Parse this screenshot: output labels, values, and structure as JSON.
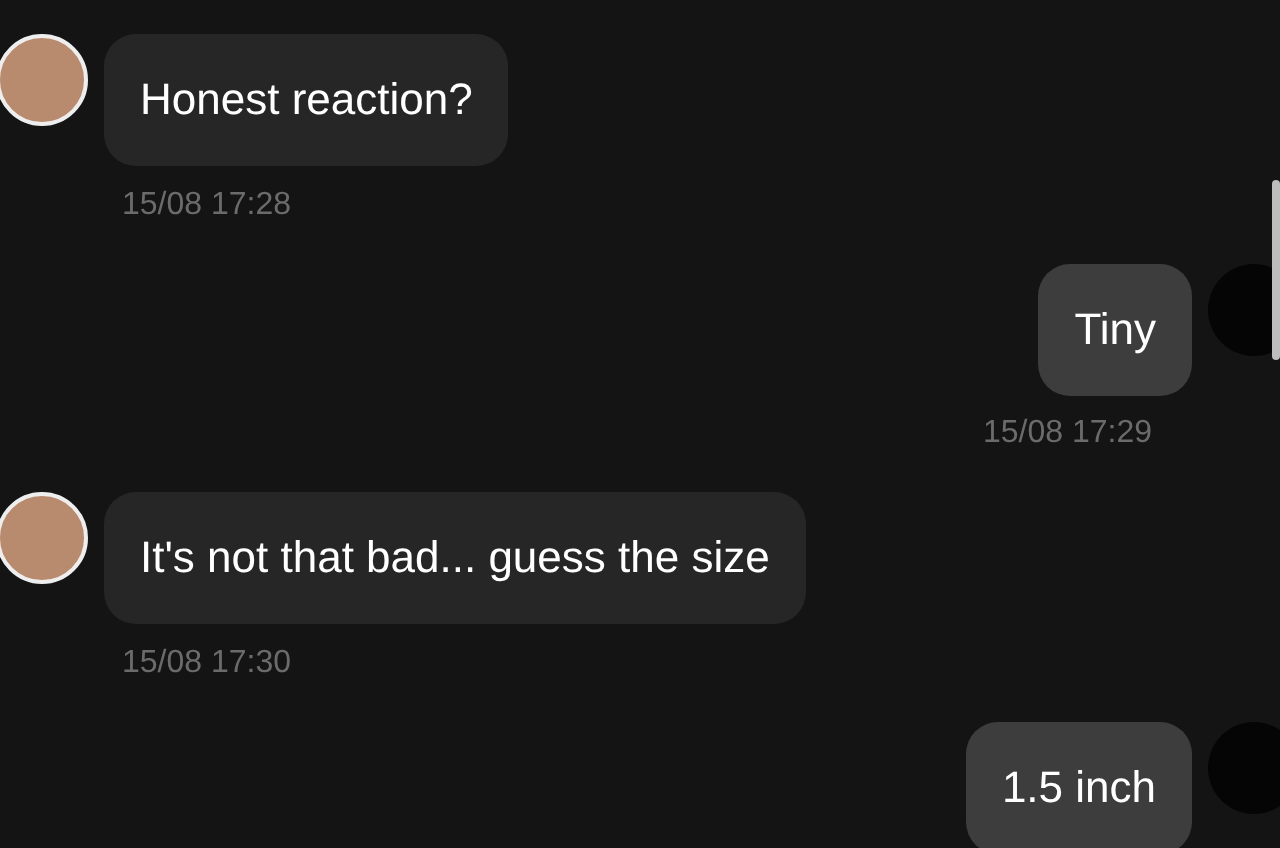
{
  "messages": [
    {
      "kind": "incoming",
      "text": "Honest reaction?",
      "time": "15/08 17:28"
    },
    {
      "kind": "outgoing",
      "text": "Tiny",
      "time": "15/08 17:29"
    },
    {
      "kind": "incoming",
      "text": "It's not that bad... guess the size",
      "time": "15/08 17:30"
    },
    {
      "kind": "outgoing",
      "text": "1.5 inch"
    }
  ]
}
